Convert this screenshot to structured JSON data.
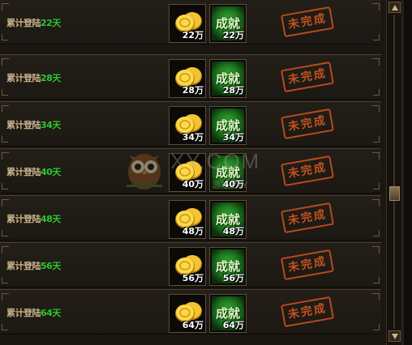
{
  "rows": [
    {
      "label": "累计登陆",
      "days": "22天",
      "coin_amount": "22万",
      "ach_amount": "22万",
      "ach_text": "成就",
      "status": "未完成"
    },
    {
      "label": "累计登陆",
      "days": "28天",
      "coin_amount": "28万",
      "ach_amount": "28万",
      "ach_text": "成就",
      "status": "未完成"
    },
    {
      "label": "累计登陆",
      "days": "34天",
      "coin_amount": "34万",
      "ach_amount": "34万",
      "ach_text": "成就",
      "status": "未完成"
    },
    {
      "label": "累计登陆",
      "days": "40天",
      "coin_amount": "40万",
      "ach_amount": "40万",
      "ach_text": "成就",
      "status": "未完成"
    },
    {
      "label": "累计登陆",
      "days": "48天",
      "coin_amount": "48万",
      "ach_amount": "48万",
      "ach_text": "成就",
      "status": "未完成"
    },
    {
      "label": "累计登陆",
      "days": "56天",
      "coin_amount": "56万",
      "ach_amount": "56万",
      "ach_text": "成就",
      "status": "未完成"
    },
    {
      "label": "累计登陆",
      "days": "64天",
      "coin_amount": "64万",
      "ach_amount": "64万",
      "ach_text": "成就",
      "status": "未完成"
    }
  ],
  "watermark": {
    "big": "XY.COM",
    "small": "游戏上XY"
  },
  "icons": {
    "coin": "gold-coin-icon",
    "achievement": "achievement-icon",
    "owl": "owl-logo-icon"
  },
  "colors": {
    "days": "#2ec72e",
    "stamp": "#d2581f",
    "label": "#c9b48a"
  },
  "scrollbar": {
    "position": 0.55
  }
}
